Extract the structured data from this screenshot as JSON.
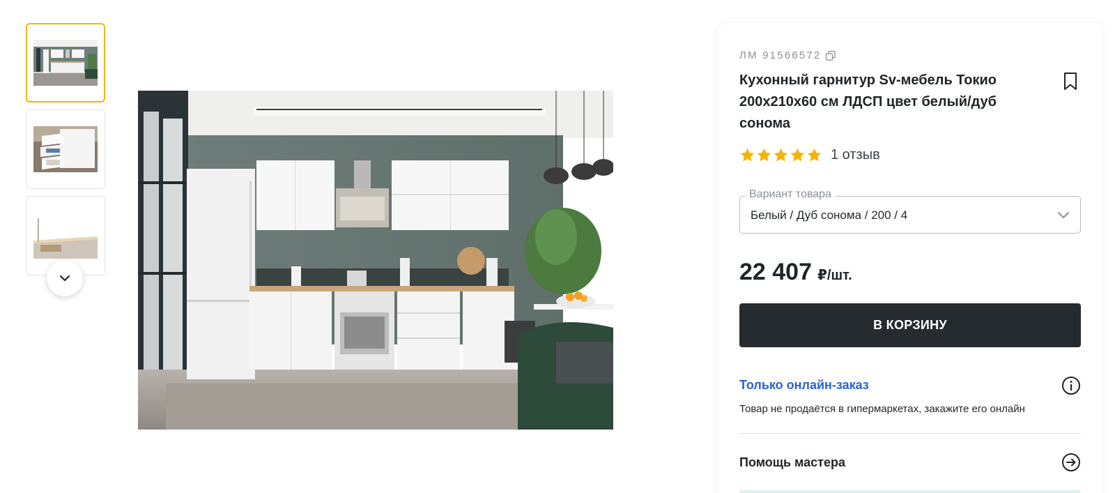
{
  "gallery": {
    "thumbnails": [
      {
        "alt": "kitchen-overview",
        "active": true
      },
      {
        "alt": "open-drawers",
        "active": false
      },
      {
        "alt": "cabinet-lighting",
        "active": false
      }
    ],
    "scroll_icon": "chevron-down-icon"
  },
  "product": {
    "sku_label": "ЛМ 91566572",
    "title": "Кухонный гарнитур Sv-мебель Токио 200x210x60 см ЛДСП цвет белый/дуб сонома",
    "rating": 5,
    "reviews_label": "1 отзыв",
    "variant": {
      "legend": "Вариант товара",
      "value": "Белый / Дуб сонома / 200 / 4"
    },
    "price": "22 407",
    "price_unit": "₽/шт.",
    "cart_button_label": "В КОРЗИНУ",
    "online_only": {
      "title": "Только онлайн-заказ",
      "description": "Товар не продаётся в гипермаркетах, закажите его онлайн"
    },
    "help_label": "Помощь мастера"
  },
  "colors": {
    "accent_yellow": "#f5b400",
    "button_dark": "#262b30",
    "link_blue": "#2a62d6",
    "star": "#f5b400"
  }
}
